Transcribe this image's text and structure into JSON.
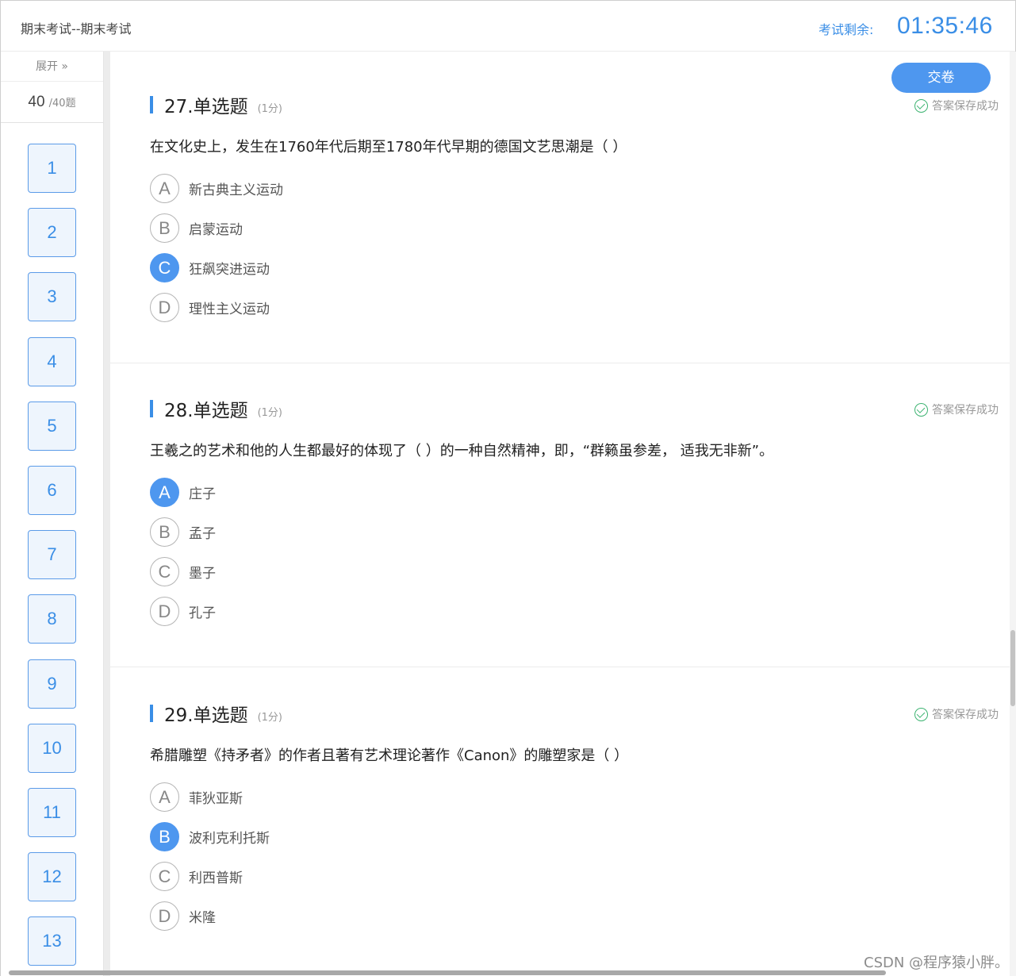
{
  "header": {
    "title": "期末考试--期末考试",
    "timer_label": "考试剩余:",
    "timer_value": "01:35:46"
  },
  "sidebar": {
    "expand_label": "展开 »",
    "current_count": "40",
    "total_label": "/40题",
    "numbers": [
      "1",
      "2",
      "3",
      "4",
      "5",
      "6",
      "7",
      "8",
      "9",
      "10",
      "11",
      "12",
      "13"
    ]
  },
  "submit_label": "交卷",
  "saved_label": "答案保存成功",
  "questions": [
    {
      "title": "27.单选题",
      "score": "(1分)",
      "text": "在文化史上，发生在1760年代后期至1780年代早期的德国文艺思潮是（ ）",
      "options": [
        {
          "letter": "A",
          "text": "新古典主义运动",
          "selected": false
        },
        {
          "letter": "B",
          "text": "启蒙运动",
          "selected": false
        },
        {
          "letter": "C",
          "text": "狂飙突进运动",
          "selected": true
        },
        {
          "letter": "D",
          "text": "理性主义运动",
          "selected": false
        }
      ]
    },
    {
      "title": "28.单选题",
      "score": "(1分)",
      "text": "王羲之的艺术和他的人生都最好的体现了（ ）的一种自然精神，即，“群籁虽参差， 适我无非新”。",
      "options": [
        {
          "letter": "A",
          "text": "庄子",
          "selected": true
        },
        {
          "letter": "B",
          "text": "孟子",
          "selected": false
        },
        {
          "letter": "C",
          "text": "墨子",
          "selected": false
        },
        {
          "letter": "D",
          "text": "孔子",
          "selected": false
        }
      ]
    },
    {
      "title": "29.单选题",
      "score": "(1分)",
      "text": "希腊雕塑《持矛者》的作者且著有艺术理论著作《Canon》的雕塑家是（ ）",
      "options": [
        {
          "letter": "A",
          "text": "菲狄亚斯",
          "selected": false
        },
        {
          "letter": "B",
          "text": "波利克利托斯",
          "selected": true
        },
        {
          "letter": "C",
          "text": "利西普斯",
          "selected": false
        },
        {
          "letter": "D",
          "text": "米隆",
          "selected": false
        }
      ]
    }
  ],
  "watermark": "CSDN @程序猿小胖。",
  "colors": {
    "accent": "#3a8ee6",
    "selected": "#4e97ef",
    "saved_check": "#3cb371"
  }
}
